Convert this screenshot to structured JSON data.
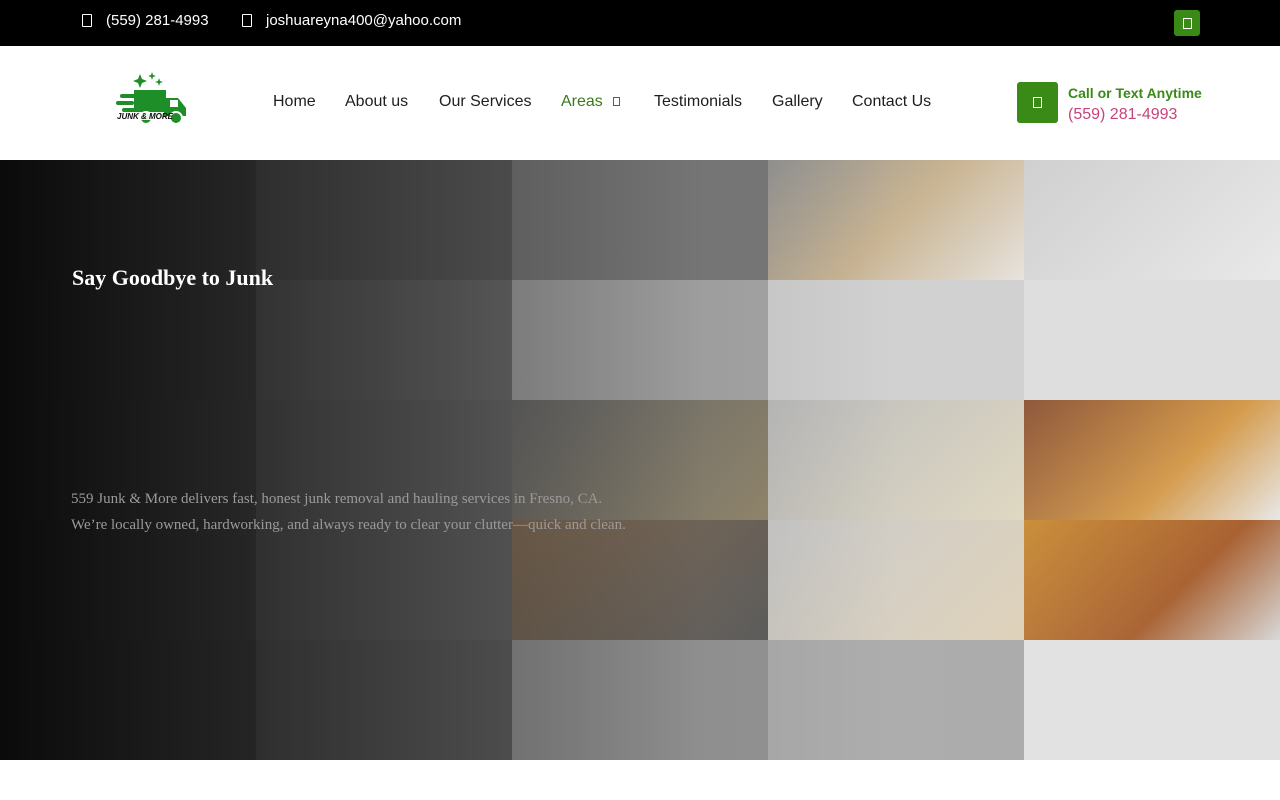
{
  "topbar": {
    "phone": "(559) 281-4993",
    "email": "joshuareyna400@yahoo.com",
    "phone_icon": "phone-icon",
    "email_icon": "envelope-icon",
    "social_icon": "facebook-icon"
  },
  "header": {
    "logo_text": "JUNK & MORE",
    "nav": [
      {
        "label": "Home"
      },
      {
        "label": "About us"
      },
      {
        "label": "Our Services"
      },
      {
        "label": "Areas",
        "active": true
      },
      {
        "label": "Testimonials"
      },
      {
        "label": "Gallery"
      },
      {
        "label": "Contact Us"
      }
    ],
    "cta_label": "Call or Text Anytime",
    "cta_phone": "(559) 281-4993",
    "cta_icon": "phone-icon"
  },
  "hero": {
    "title": "Say Goodbye to Junk",
    "text_line1": "559 Junk & More delivers fast, honest junk removal and hauling services in Fresno, CA.",
    "text_line2": "We’re locally owned, hardworking, and always ready to clear your clutter—quick and clean."
  },
  "colors": {
    "brand_green": "#3a8a17",
    "cta_phone": "#c9437a",
    "topbar_bg": "#000000"
  }
}
